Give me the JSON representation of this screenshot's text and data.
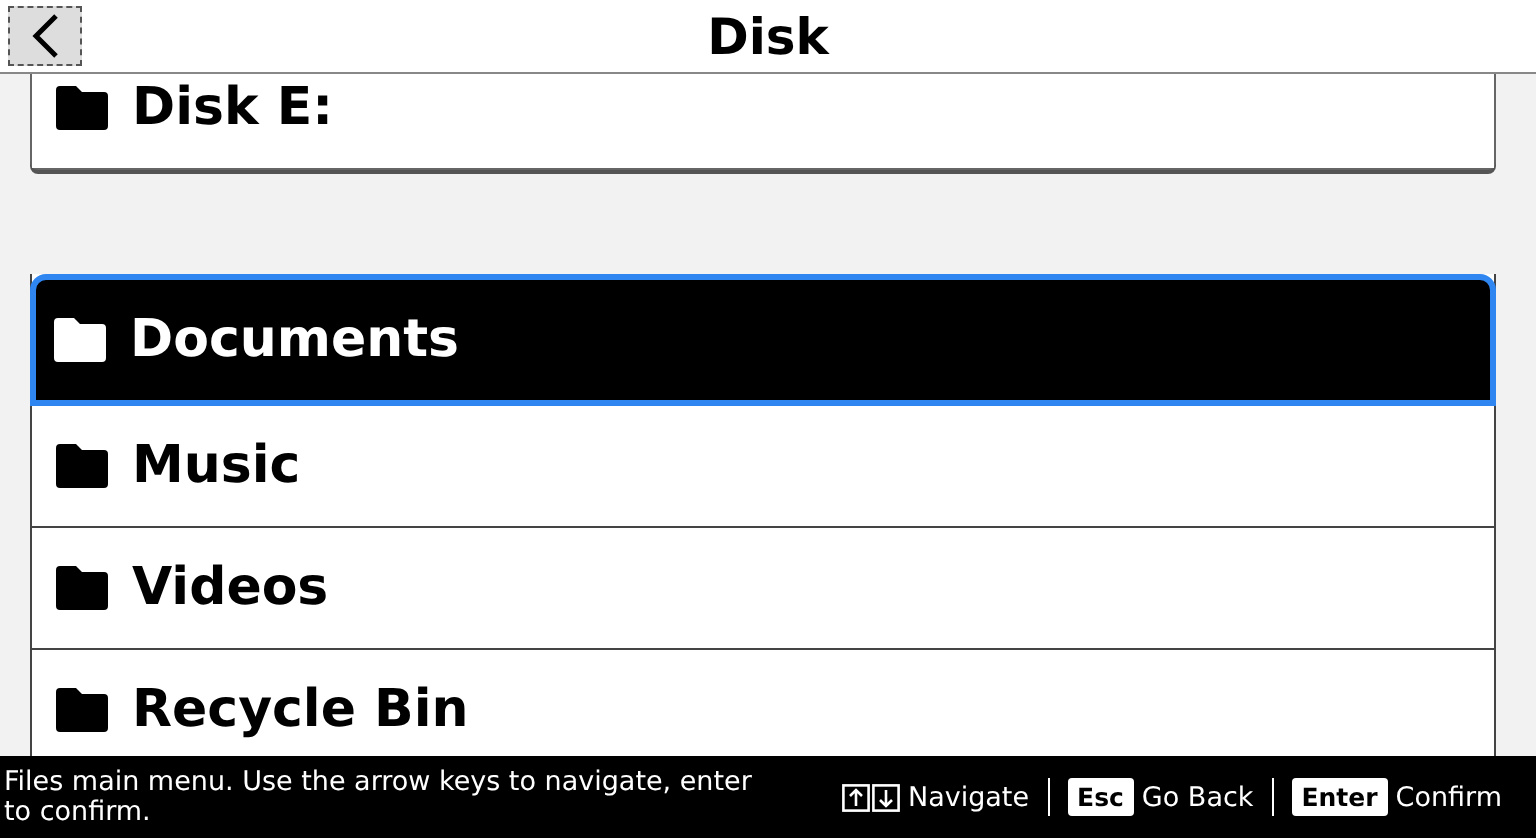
{
  "header": {
    "title": "Disk"
  },
  "drives": [
    {
      "label": "Disk E:",
      "selected": false
    }
  ],
  "folders": [
    {
      "label": "Documents",
      "selected": true
    },
    {
      "label": "Music",
      "selected": false
    },
    {
      "label": "Videos",
      "selected": false
    },
    {
      "label": "Recycle Bin",
      "selected": false
    }
  ],
  "status_bar": {
    "message": "Files main menu. Use the arrow keys to navigate, enter to confirm.",
    "hints": [
      {
        "kind": "arrows",
        "label": "Navigate"
      },
      {
        "kind": "key",
        "key": "Esc",
        "label": "Go Back"
      },
      {
        "kind": "key",
        "key": "Enter",
        "label": "Confirm"
      }
    ]
  }
}
